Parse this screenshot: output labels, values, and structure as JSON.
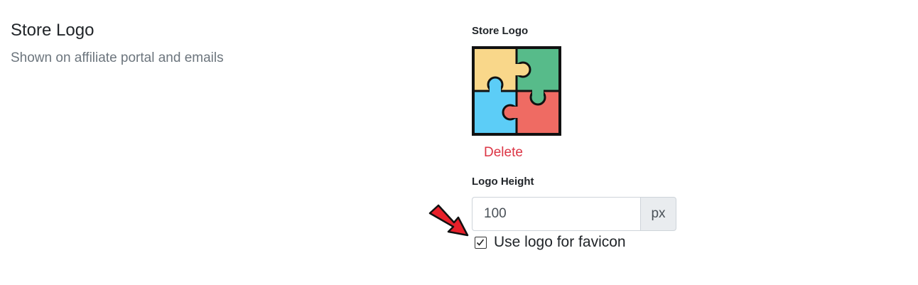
{
  "section": {
    "title": "Store Logo",
    "description": "Shown on affiliate portal and emails"
  },
  "logo_field": {
    "label": "Store Logo",
    "image_icon": "puzzle-pieces-icon",
    "delete_label": "Delete"
  },
  "height_field": {
    "label": "Logo Height",
    "value": "100",
    "unit": "px"
  },
  "favicon_option": {
    "label": "Use logo for favicon",
    "checked": true
  },
  "colors": {
    "delete": "#dc3545",
    "muted_text": "#6c757d",
    "annotation_arrow": "#e8202a",
    "puzzle_yellow": "#f9d78a",
    "puzzle_green": "#57bb8a",
    "puzzle_blue": "#5ccdf7",
    "puzzle_red": "#ef6b63"
  }
}
